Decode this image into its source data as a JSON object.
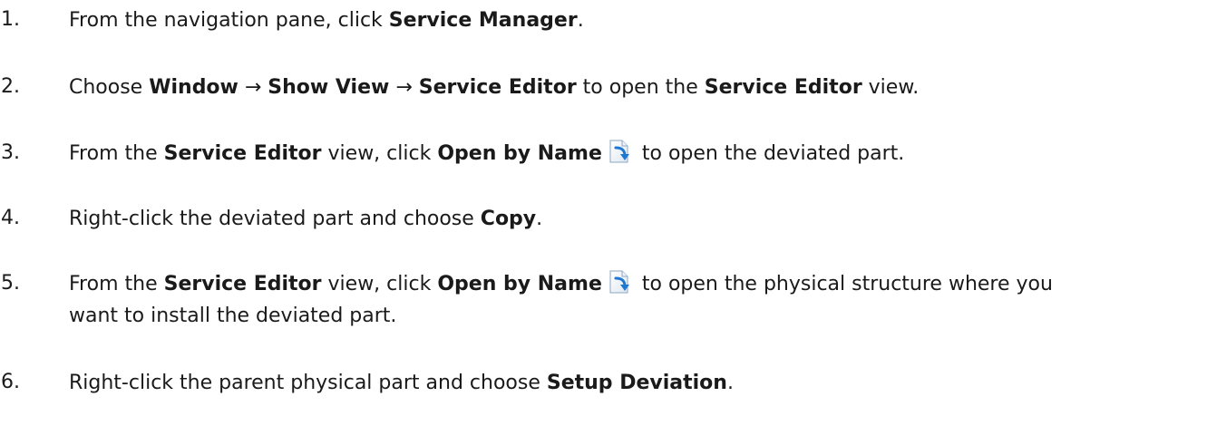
{
  "steps": [
    {
      "number": "1.",
      "parts": [
        "From the navigation pane, click ",
        "Service Manager",
        "."
      ]
    },
    {
      "number": "2.",
      "parts": [
        "Choose ",
        "Window",
        " → ",
        "Show View",
        " → ",
        "Service Editor",
        " to open the ",
        "Service Editor",
        " view."
      ]
    },
    {
      "number": "3.",
      "parts": [
        "From the ",
        "Service Editor",
        " view, click ",
        "Open by Name",
        " to open the deviated part."
      ]
    },
    {
      "number": "4.",
      "parts": [
        "Right-click the deviated part and choose ",
        "Copy",
        "."
      ]
    },
    {
      "number": "5.",
      "parts": [
        "From the ",
        "Service Editor",
        " view, click ",
        "Open by Name",
        " to open the physical structure where you",
        "want to install the deviated part."
      ]
    },
    {
      "number": "6.",
      "parts": [
        "Right-click the parent physical part and choose ",
        "Setup Deviation",
        "."
      ]
    }
  ],
  "icons": [
    "open-by-name-icon"
  ]
}
